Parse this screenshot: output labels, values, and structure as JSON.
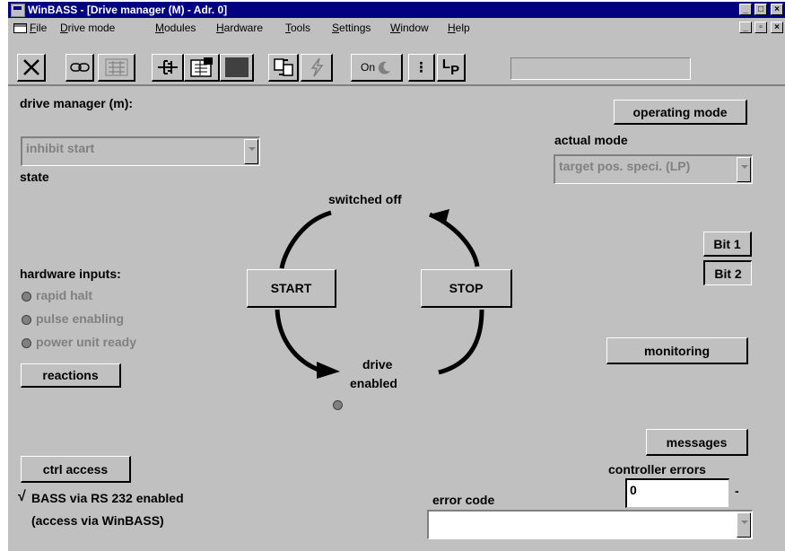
{
  "window": {
    "title": "WinBASS - [Drive manager (M) - Adr. 0]",
    "minimize": "_",
    "maximize": "□",
    "close": "×",
    "restore": "▫"
  },
  "menu": [
    "File",
    "Drive mode",
    "Modules",
    "Hardware",
    "Tools",
    "Settings",
    "Window",
    "Help"
  ],
  "toolbar": {
    "on_label": "On",
    "lp_label": "L",
    "lp_sub": "P",
    "colon_label": "⁝"
  },
  "drive_manager": {
    "heading": "drive manager (m):",
    "state_value": "inhibit start",
    "state_label": "state"
  },
  "operating_mode": {
    "button": "operating mode",
    "actual_label": "actual mode",
    "actual_value": "target pos. speci. (LP)"
  },
  "cycle": {
    "switched_off": "switched off",
    "drive_line1": "drive",
    "drive_line2": "enabled",
    "start_button": "START",
    "stop_button": "STOP"
  },
  "bits": [
    "Bit 1",
    "Bit 2"
  ],
  "hardware_inputs": {
    "heading": "hardware inputs:",
    "items": [
      "rapid halt",
      "pulse enabling",
      "power unit ready"
    ],
    "reactions_button": "reactions"
  },
  "monitoring_button": "monitoring",
  "messages_button": "messages",
  "controller_errors": {
    "label": "controller errors",
    "value": "0",
    "dash": "-"
  },
  "access": {
    "button": "ctrl access",
    "check": "√",
    "line1": "BASS via RS 232 enabled",
    "line2": "(access via WinBASS)"
  },
  "error_code": {
    "label": "error code",
    "value": ""
  }
}
